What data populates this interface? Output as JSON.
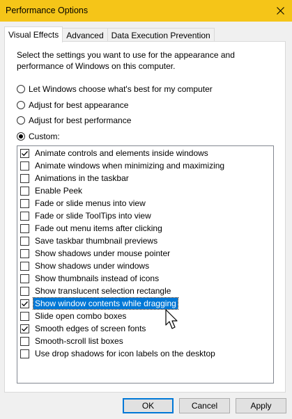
{
  "window": {
    "title": "Performance Options",
    "title_bar_color": "#f5c518"
  },
  "tabs": [
    {
      "label": "Visual Effects",
      "active": true
    },
    {
      "label": "Advanced",
      "active": false
    },
    {
      "label": "Data Execution Prevention",
      "active": false
    }
  ],
  "description": "Select the settings you want to use for the appearance and performance of Windows on this computer.",
  "radios": [
    {
      "label": "Let Windows choose what's best for my computer",
      "checked": false
    },
    {
      "label": "Adjust for best appearance",
      "checked": false
    },
    {
      "label": "Adjust for best performance",
      "checked": false
    },
    {
      "label": "Custom:",
      "checked": true
    }
  ],
  "options": [
    {
      "label": "Animate controls and elements inside windows",
      "checked": true,
      "selected": false
    },
    {
      "label": "Animate windows when minimizing and maximizing",
      "checked": false,
      "selected": false
    },
    {
      "label": "Animations in the taskbar",
      "checked": false,
      "selected": false
    },
    {
      "label": "Enable Peek",
      "checked": false,
      "selected": false
    },
    {
      "label": "Fade or slide menus into view",
      "checked": false,
      "selected": false
    },
    {
      "label": "Fade or slide ToolTips into view",
      "checked": false,
      "selected": false
    },
    {
      "label": "Fade out menu items after clicking",
      "checked": false,
      "selected": false
    },
    {
      "label": "Save taskbar thumbnail previews",
      "checked": false,
      "selected": false
    },
    {
      "label": "Show shadows under mouse pointer",
      "checked": false,
      "selected": false
    },
    {
      "label": "Show shadows under windows",
      "checked": false,
      "selected": false
    },
    {
      "label": "Show thumbnails instead of icons",
      "checked": false,
      "selected": false
    },
    {
      "label": "Show translucent selection rectangle",
      "checked": false,
      "selected": false
    },
    {
      "label": "Show window contents while dragging",
      "checked": true,
      "selected": true
    },
    {
      "label": "Slide open combo boxes",
      "checked": false,
      "selected": false
    },
    {
      "label": "Smooth edges of screen fonts",
      "checked": true,
      "selected": false
    },
    {
      "label": "Smooth-scroll list boxes",
      "checked": false,
      "selected": false
    },
    {
      "label": "Use drop shadows for icon labels on the desktop",
      "checked": false,
      "selected": false
    }
  ],
  "buttons": {
    "ok": "OK",
    "cancel": "Cancel",
    "apply": "Apply"
  },
  "icons": {
    "close": "close-icon",
    "check": "checkmark-icon",
    "cursor": "mouse-pointer-icon"
  },
  "colors": {
    "selection": "#0078d7",
    "panel": "#ffffff",
    "window_bg": "#f0f0f0"
  }
}
